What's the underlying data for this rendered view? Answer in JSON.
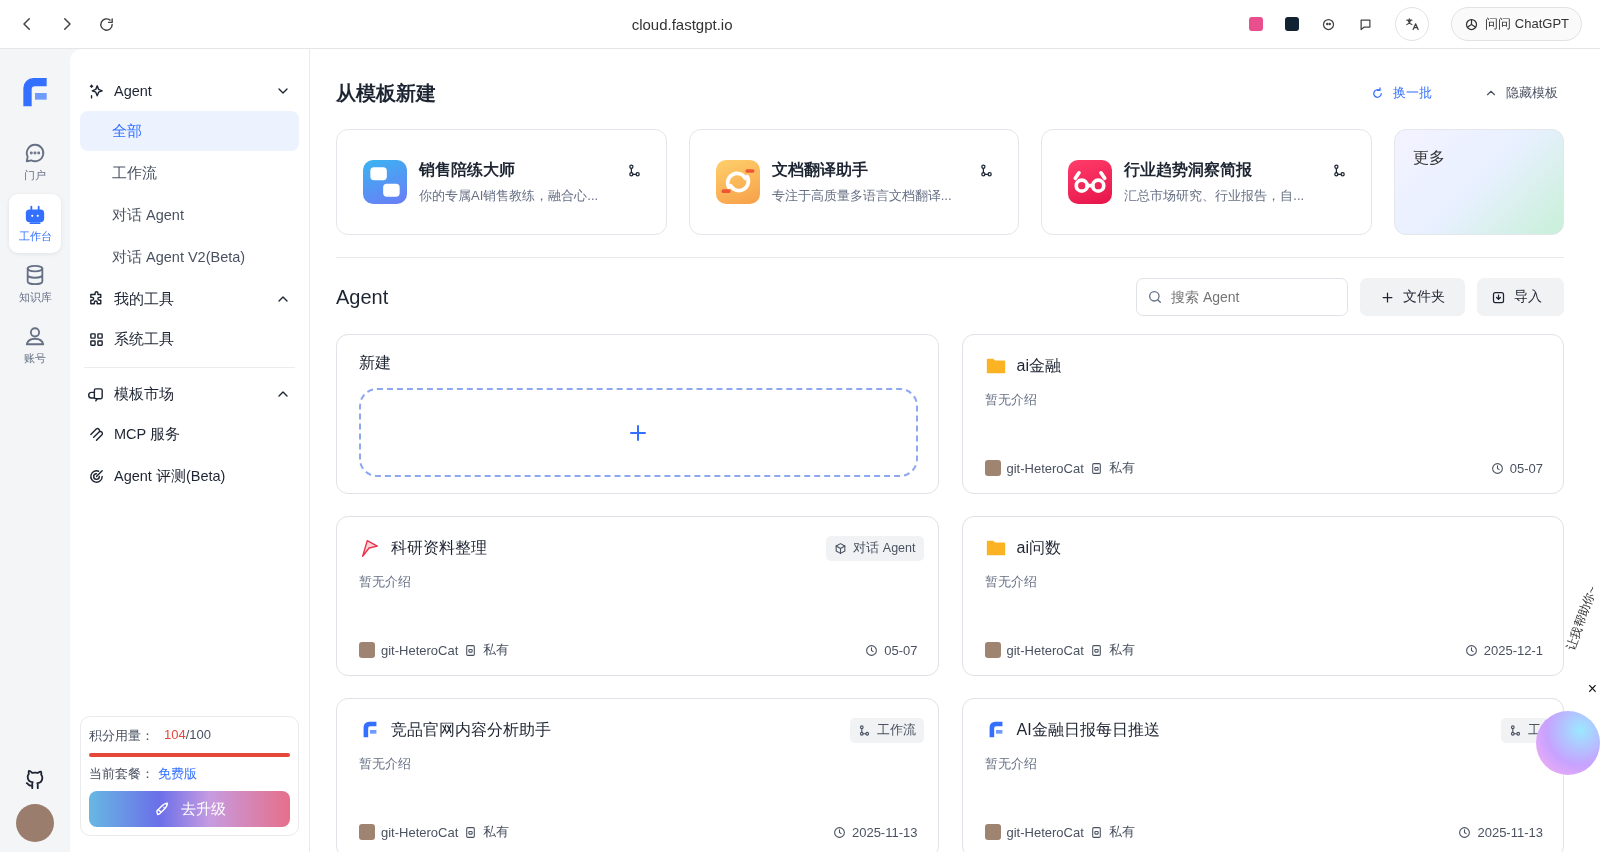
{
  "browser": {
    "url": "cloud.fastgpt.io",
    "extension_button": "问问 ChatGPT"
  },
  "rail": {
    "items": [
      {
        "kind": "chat",
        "label": "门户",
        "selected": false
      },
      {
        "kind": "robot",
        "label": "工作台",
        "selected": true
      },
      {
        "kind": "database",
        "label": "知识库",
        "selected": false
      },
      {
        "kind": "user",
        "label": "账号",
        "selected": false
      }
    ]
  },
  "sidebar": {
    "sections": [
      {
        "label": "Agent",
        "expanded": true,
        "children": [
          {
            "label": "全部",
            "selected": true
          },
          {
            "label": "工作流",
            "selected": false
          },
          {
            "label": "对话 Agent",
            "selected": false
          },
          {
            "label": "对话 Agent V2(Beta)",
            "selected": false
          }
        ]
      },
      {
        "label": "我的工具",
        "expanded": false,
        "children": [
          {
            "kind": "tool",
            "label": "系统工具",
            "selected": false
          }
        ]
      },
      {
        "label": "模板市场",
        "expanded": false,
        "children": [
          {
            "kind": "tool",
            "label": "MCP 服务",
            "selected": false
          },
          {
            "kind": "tool",
            "label": "Agent 评测(Beta)",
            "selected": false
          }
        ]
      }
    ],
    "usage": {
      "label": "积分用量：",
      "used": "104",
      "total": "/100",
      "level": 1,
      "plan_label": "当前套餐：",
      "plan": "免费版",
      "upgrade": "去升级"
    }
  },
  "templates": {
    "title": "从模板新建",
    "refresh": "换一批",
    "hide": "隐藏模板",
    "more": "更多",
    "cards": [
      {
        "name": "销售陪练大师",
        "desc": "你的专属AI销售教练，融合心..."
      },
      {
        "name": "文档翻译助手",
        "desc": "专注于高质量多语言文档翻译..."
      },
      {
        "name": "行业趋势洞察简报",
        "desc": "汇总市场研究、行业报告，自..."
      }
    ]
  },
  "agents": {
    "title": "Agent",
    "search": {
      "placeholder": "搜索 Agent"
    },
    "folder_button": "文件夹",
    "import_button": "导入",
    "new_card": "新建",
    "items": [
      {
        "kind": "folder",
        "name": "ai金融",
        "desc": "暂无介绍",
        "owner": "git-HeteroCat",
        "visibility": "私有",
        "date": "05-07"
      },
      {
        "kind": "chat",
        "name": "科研资料整理",
        "tag": "对话 Agent",
        "desc": "暂无介绍",
        "owner": "git-HeteroCat",
        "visibility": "私有",
        "date": "05-07"
      },
      {
        "kind": "folder",
        "name": "ai问数",
        "desc": "暂无介绍",
        "owner": "git-HeteroCat",
        "visibility": "私有",
        "date": "2025-12-1"
      },
      {
        "kind": "workflow",
        "name": "竞品官网内容分析助手",
        "tag": "工作流",
        "desc": "暂无介绍",
        "owner": "git-HeteroCat",
        "visibility": "私有",
        "date": "2025-11-13"
      },
      {
        "kind": "workflow",
        "name": "AI金融日报每日推送",
        "tag": "工",
        "desc": "暂无介绍",
        "owner": "git-HeteroCat",
        "visibility": "私有",
        "date": "2025-11-13"
      }
    ]
  },
  "assistant": {
    "bubble": "让我帮助你~",
    "close": "×"
  }
}
